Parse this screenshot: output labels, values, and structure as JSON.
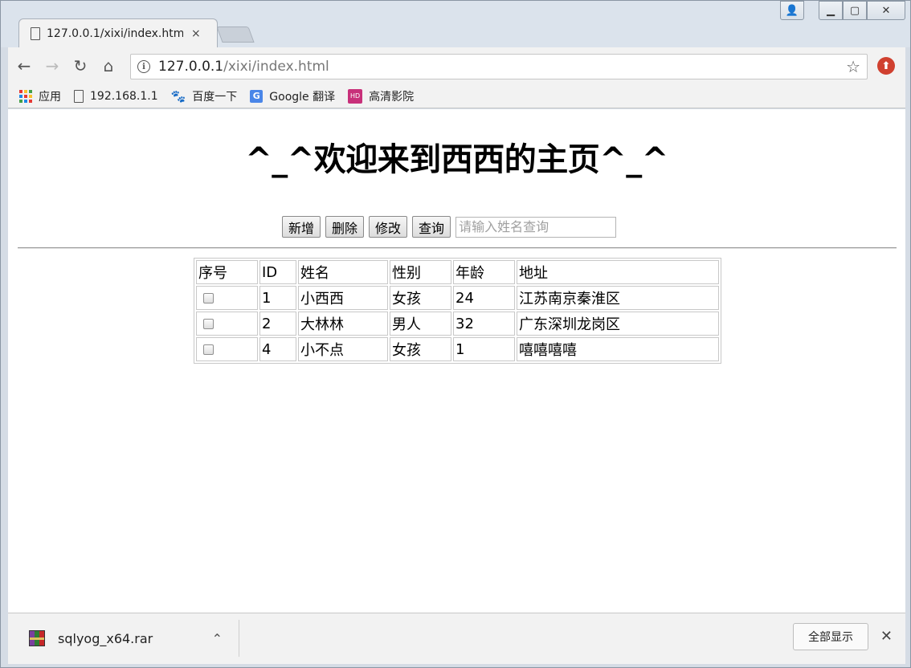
{
  "browser": {
    "tab_title": "127.0.0.1/xixi/index.htm",
    "tab_close": "×",
    "url_host": "127.0.0.1",
    "url_path": "/xixi/index.html",
    "bookmarks": [
      {
        "label": "应用",
        "icon": "apps-grid-icon"
      },
      {
        "label": "192.168.1.1",
        "icon": "page-icon"
      },
      {
        "label": "百度一下",
        "icon": "baidu-paw-icon"
      },
      {
        "label": "Google 翻译",
        "icon": "google-translate-icon"
      },
      {
        "label": "高清影院",
        "icon": "hd-cinema-icon"
      }
    ]
  },
  "page": {
    "title": "^_^欢迎来到西西的主页^_^",
    "buttons": {
      "add": "新增",
      "delete": "删除",
      "edit": "修改",
      "query": "查询"
    },
    "search_placeholder": "请输入姓名查询",
    "table": {
      "headers": [
        "序号",
        "ID",
        "姓名",
        "性别",
        "年龄",
        "地址"
      ],
      "rows": [
        {
          "id": "1",
          "name": "小西西",
          "gender": "女孩",
          "age": "24",
          "address": "江苏南京秦淮区"
        },
        {
          "id": "2",
          "name": "大林林",
          "gender": "男人",
          "age": "32",
          "address": "广东深圳龙岗区"
        },
        {
          "id": "4",
          "name": "小不点",
          "gender": "女孩",
          "age": "1",
          "address": "嘻嘻嘻嘻"
        }
      ]
    }
  },
  "downloads": {
    "file_name": "sqlyog_x64.rar",
    "show_all": "全部显示",
    "close": "✕"
  },
  "colors": {
    "extension_badge": "#d0402f",
    "google_translate": "#4a86e8",
    "hd_cinema": "#c8307a"
  }
}
